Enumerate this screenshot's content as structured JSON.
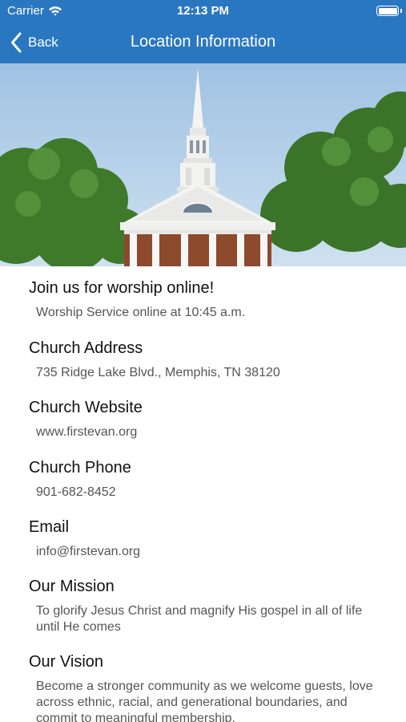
{
  "status_bar": {
    "carrier": "Carrier",
    "time": "12:13 PM",
    "battery_level": 1.0
  },
  "nav": {
    "back_label": "Back",
    "title": "Location Information",
    "background_color": "#2a77c1"
  },
  "hero_image": {
    "subject": "white church steeple among green trees under blue sky"
  },
  "sections": [
    {
      "title": "Join us for worship online!",
      "value": "Worship Service online at 10:45 a.m."
    },
    {
      "title": "Church Address",
      "value": "735 Ridge Lake Blvd., Memphis, TN 38120"
    },
    {
      "title": "Church Website",
      "value": "www.firstevan.org"
    },
    {
      "title": "Church Phone",
      "value": "901-682-8452"
    },
    {
      "title": "Email",
      "value": "info@firstevan.org"
    },
    {
      "title": "Our Mission",
      "value": "To glorify Jesus Christ and magnify His gospel in all of life until He comes"
    },
    {
      "title": "Our Vision",
      "value": "Become a stronger community as we welcome guests, love across ethnic, racial, and generational boundaries, and commit to meaningful membership."
    }
  ]
}
